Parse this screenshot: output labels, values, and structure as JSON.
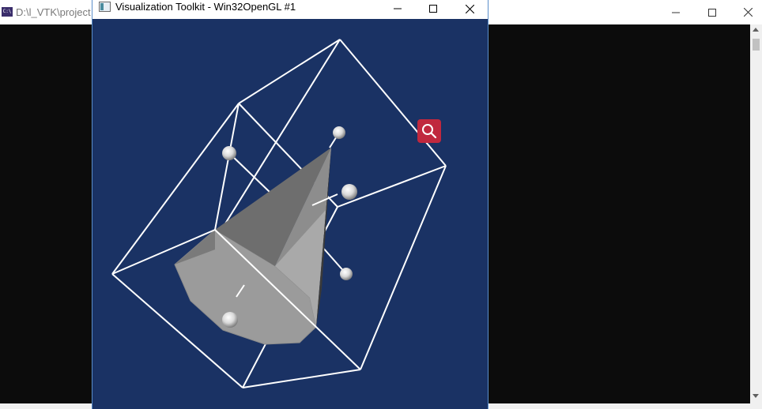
{
  "console_window": {
    "title": "D:\\l_VTK\\project",
    "icon_text": "C:\\",
    "icons": {
      "minimize": "minimize-icon",
      "maximize": "maximize-icon",
      "close": "close-icon"
    }
  },
  "vtk_window": {
    "title": "Visualization Toolkit - Win32OpenGL #1",
    "background_color": "#1a3264",
    "icons": {
      "minimize": "minimize-icon",
      "maximize": "maximize-icon",
      "close": "close-icon"
    },
    "scene": {
      "objects": [
        "bounding-box-wireframe",
        "cone",
        "widget-handles"
      ],
      "widget_handle_count": 6,
      "zoom_button_icon": "magnifier-icon",
      "zoom_button_color": "#c0283e"
    }
  }
}
